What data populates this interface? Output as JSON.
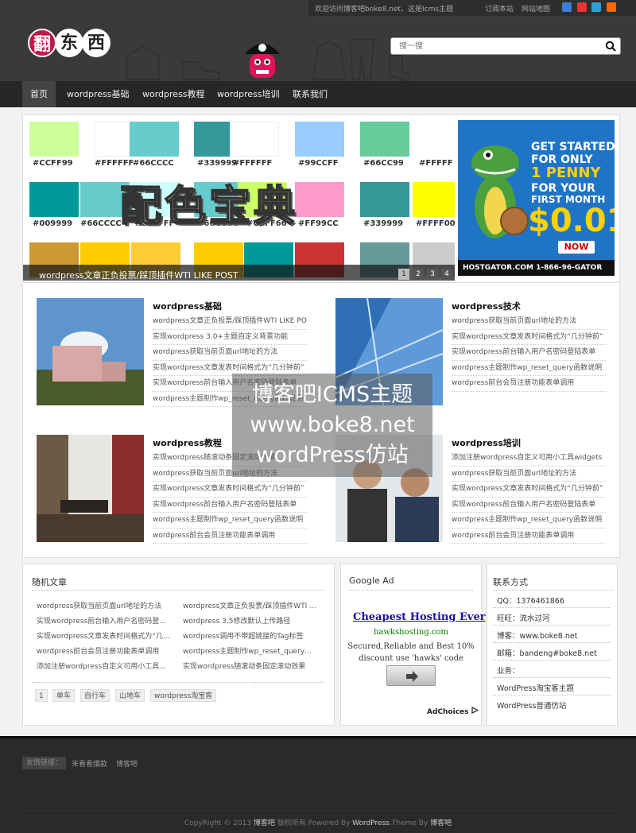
{
  "topbar": {
    "welcome": "欢迎访问博客吧boke8.net，这是Icms主题",
    "subscribe": "订阅本站",
    "sitemap": "网站地图"
  },
  "logo": {
    "chars": [
      "翻",
      "东",
      "西"
    ]
  },
  "search": {
    "placeholder": "搜一搜"
  },
  "nav": {
    "items": [
      "首页",
      "wordpress基础",
      "wordpress教程",
      "wordpress培训",
      "联系我们"
    ]
  },
  "slider": {
    "swatches": [
      "#CCFF99",
      "#FFFFFF",
      "#66CCCC",
      "#339999",
      "#FFFFFF",
      "#99CCFF",
      "#66CC99",
      "#FFFFF",
      "#009999",
      "#66CCCC",
      "#CCFFFF",
      "#66CCCC",
      "#CCFF66",
      "#FF99CC",
      "#339999",
      "#FFFF00"
    ],
    "title": "配色宝典",
    "caption": "wordpress文章正负投票/踩顶插件WTI LIKE POST",
    "pages": [
      "1",
      "2",
      "3",
      "4"
    ]
  },
  "ad_banner": {
    "line1": "GET STARTED",
    "line2": "FOR ONLY",
    "line3": "1 PENNY",
    "line4": "FOR YOUR",
    "line5": "FIRST MONTH",
    "price": "$0.01",
    "now": "NOW",
    "footer": "HOSTGATOR.COM  1-866-96-GATOR"
  },
  "categories": [
    {
      "title": "wordpress基础",
      "posts": [
        "wordpress文章正负投票/踩顶插件WTI LIKE POST",
        "实现wordpress 3.0+主题自定义背景功能",
        "wordpress获取当前页面url地址的方法",
        "实现wordpress文章发表时间格式为“几分钟前”",
        "实现wordpress前台输入用户名密码登陆表单",
        "wordpress主题制作wp_reset_query函数说明"
      ]
    },
    {
      "title": "wordpress技术",
      "posts": [
        "wordpress获取当前页面url地址的方法",
        "实现wordpress文章发表时间格式为“几分钟前”",
        "实现wordpress前台输入用户名密码登陆表单",
        "wordpress主题制作wp_reset_query函数说明",
        "wordpress前台会员注册功能表单调用"
      ]
    },
    {
      "title": "wordpress教程",
      "posts": [
        "实现wordpress随滚动条固定滚动效果",
        "wordpress获取当前页面url地址的方法",
        "实现wordpress文章发表时间格式为“几分钟前”",
        "实现wordpress前台输入用户名密码登陆表单",
        "wordpress主题制作wp_reset_query函数说明",
        "wordpress前台会员注册功能表单调用"
      ]
    },
    {
      "title": "wordpress培训",
      "posts": [
        "添加注册wordpress自定义可用小工具widgets",
        "wordpress获取当前页面url地址的方法",
        "实现wordpress文章发表时间格式为“几分钟前”",
        "实现wordpress前台输入用户名密码登陆表单",
        "wordpress主题制作wp_reset_query函数说明",
        "wordpress前台会员注册功能表单调用"
      ]
    }
  ],
  "watermark": {
    "line1": "博客吧ICMS主题",
    "line2": "www.boke8.net",
    "line3": "wordPress仿站"
  },
  "random": {
    "title": "随机文章",
    "left": [
      "wordpress获取当前页面url地址的方法",
      "实现wordpress前台输入用户名密码登陆表单调用",
      "实现wordpress文章发表时间格式为“几分钟前”",
      "wordpress前台会员注册功能表单调用",
      "添加注册wordpress自定义可用小工具widgets"
    ],
    "right": [
      "wordpress文章正负投票/踩顶插件WTI LIKE POST",
      "wordpress 3.5修改默认上传路径",
      "wordpress调用不带超链接的Tag标签",
      "wordpress主题制作wp_reset_query函数说明",
      "实现wordpress随滚动条固定滚动效果"
    ],
    "tags": [
      "1",
      "单车",
      "自行车",
      "山地车",
      "wordpress淘宝客"
    ]
  },
  "google_ad": {
    "title": "Google Ad",
    "headline": "Cheapest Hosting Ever",
    "url": "hawkshosting.com",
    "desc1": "Secured,Reliable and Best 10%",
    "desc2": "discount use 'hawks' code",
    "choices": "AdChoices"
  },
  "contact": {
    "title": "联系方式",
    "items": [
      "QQ：1376461866",
      "旺旺：流水过河",
      "博客：www.boke8.net",
      "邮箱：bandeng#boke8.net",
      "业务：",
      "WordPress淘宝客主题",
      "WordPress普通仿站"
    ]
  },
  "footer": {
    "links_label": "友情链接：",
    "links": [
      "来看看爆款",
      "博客吧"
    ],
    "copy_pre": "CopyRight © 2013 ",
    "copy_site": "博客吧",
    "copy_mid": " 版权所有.Powered By ",
    "copy_wp": "WordPress",
    "copy_theme": ".Theme By ",
    "copy_author": "博客吧"
  },
  "colors": {
    "header_bg": "#3a3a3a",
    "nav_bg": "#272727",
    "footer_bg": "#2a2a2a",
    "ad_blue": "#2074c6"
  }
}
